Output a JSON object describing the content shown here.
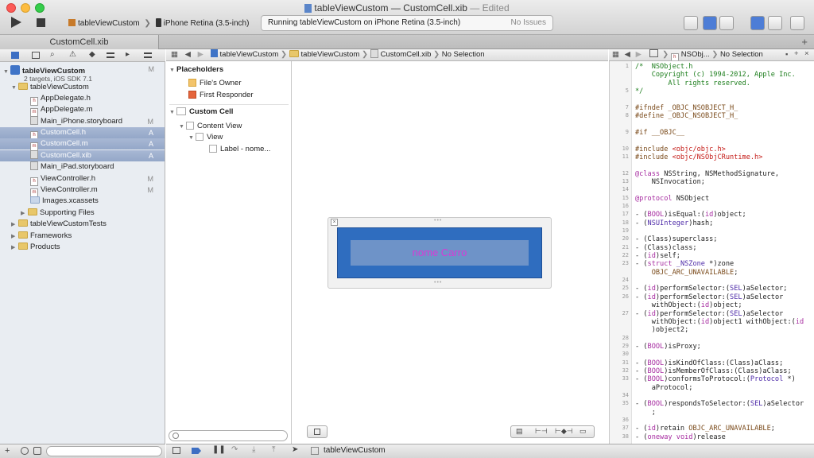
{
  "window": {
    "title_project": "tableViewCustom",
    "title_sep": " — ",
    "title_file": "CustomCell.xib",
    "title_state": " — Edited"
  },
  "toolbar": {
    "scheme": "tableViewCustom",
    "device": "iPhone Retina (3.5-inch)",
    "status": "Running tableViewCustom on iPhone Retina (3.5-inch)",
    "issues": "No Issues"
  },
  "tab": {
    "label": "CustomCell.xib"
  },
  "navigator": {
    "project": "tableViewCustom",
    "project_sub": "2 targets, iOS SDK 7.1",
    "project_badge": "M",
    "items": [
      {
        "label": "tableViewCustom",
        "badge": ""
      },
      {
        "label": "AppDelegate.h",
        "badge": ""
      },
      {
        "label": "AppDelegate.m",
        "badge": ""
      },
      {
        "label": "Main_iPhone.storyboard",
        "badge": "M"
      },
      {
        "label": "CustomCell.h",
        "badge": "A"
      },
      {
        "label": "CustomCell.m",
        "badge": "A"
      },
      {
        "label": "CustomCell.xib",
        "badge": "A"
      },
      {
        "label": "Main_iPad.storyboard",
        "badge": ""
      },
      {
        "label": "ViewController.h",
        "badge": "M"
      },
      {
        "label": "ViewController.m",
        "badge": "M"
      },
      {
        "label": "Images.xcassets",
        "badge": ""
      },
      {
        "label": "Supporting Files",
        "badge": ""
      },
      {
        "label": "tableViewCustomTests",
        "badge": ""
      },
      {
        "label": "Frameworks",
        "badge": ""
      },
      {
        "label": "Products",
        "badge": ""
      }
    ]
  },
  "editor_path": {
    "p1": "tableViewCustom",
    "p2": "tableViewCustom",
    "p3": "CustomCell.xib",
    "p4": "No Selection"
  },
  "outline": {
    "placeholders": "Placeholders",
    "files_owner": "File's Owner",
    "first_responder": "First Responder",
    "custom_cell": "Custom Cell",
    "content_view": "Content View",
    "view": "View",
    "label": "Label - nome..."
  },
  "canvas": {
    "label_text": "nome Carro",
    "label_color": "#d63bd6",
    "cell_color": "#2f6dbf"
  },
  "assistant_path": {
    "file": "NSObj...",
    "sel": "No Selection"
  },
  "code": {
    "lines": [
      {
        "n": "1",
        "t": "/*  NSObject.h"
      },
      {
        "n": "",
        "t": "    Copyright (c) 1994-2012, Apple Inc."
      },
      {
        "n": "",
        "t": "        All rights reserved."
      },
      {
        "n": "5",
        "t": "*/"
      },
      {
        "n": "",
        "t": ""
      },
      {
        "n": "7",
        "t": "#ifndef _OBJC_NSOBJECT_H_"
      },
      {
        "n": "8",
        "t": "#define _OBJC_NSOBJECT_H_"
      },
      {
        "n": "",
        "t": ""
      },
      {
        "n": "9",
        "t": "#if __OBJC__"
      },
      {
        "n": "",
        "t": ""
      },
      {
        "n": "10",
        "t": "#include <objc/objc.h>"
      },
      {
        "n": "11",
        "t": "#include <objc/NSObjCRuntime.h>"
      },
      {
        "n": "",
        "t": ""
      },
      {
        "n": "12",
        "t": "@class NSString, NSMethodSignature,"
      },
      {
        "n": "13",
        "t": "    NSInvocation;"
      },
      {
        "n": "14",
        "t": ""
      },
      {
        "n": "15",
        "t": "@protocol NSObject"
      },
      {
        "n": "16",
        "t": ""
      },
      {
        "n": "17",
        "t": "- (BOOL)isEqual:(id)object;"
      },
      {
        "n": "18",
        "t": "- (NSUInteger)hash;"
      },
      {
        "n": "19",
        "t": ""
      },
      {
        "n": "20",
        "t": "- (Class)superclass;"
      },
      {
        "n": "21",
        "t": "- (Class)class;"
      },
      {
        "n": "22",
        "t": "- (id)self;"
      },
      {
        "n": "23",
        "t": "- (struct _NSZone *)zone"
      },
      {
        "n": "",
        "t": "    OBJC_ARC_UNAVAILABLE;"
      },
      {
        "n": "24",
        "t": ""
      },
      {
        "n": "25",
        "t": "- (id)performSelector:(SEL)aSelector;"
      },
      {
        "n": "26",
        "t": "- (id)performSelector:(SEL)aSelector"
      },
      {
        "n": "",
        "t": "    withObject:(id)object;"
      },
      {
        "n": "27",
        "t": "- (id)performSelector:(SEL)aSelector"
      },
      {
        "n": "",
        "t": "    withObject:(id)object1 withObject:(id"
      },
      {
        "n": "",
        "t": "    )object2;"
      },
      {
        "n": "28",
        "t": ""
      },
      {
        "n": "29",
        "t": "- (BOOL)isProxy;"
      },
      {
        "n": "30",
        "t": ""
      },
      {
        "n": "31",
        "t": "- (BOOL)isKindOfClass:(Class)aClass;"
      },
      {
        "n": "32",
        "t": "- (BOOL)isMemberOfClass:(Class)aClass;"
      },
      {
        "n": "33",
        "t": "- (BOOL)conformsToProtocol:(Protocol *)"
      },
      {
        "n": "",
        "t": "    aProtocol;"
      },
      {
        "n": "34",
        "t": ""
      },
      {
        "n": "35",
        "t": "- (BOOL)respondsToSelector:(SEL)aSelector"
      },
      {
        "n": "",
        "t": "    ;"
      },
      {
        "n": "36",
        "t": ""
      },
      {
        "n": "37",
        "t": "- (id)retain OBJC_ARC_UNAVAILABLE;"
      },
      {
        "n": "38",
        "t": "- (oneway void)release"
      }
    ]
  },
  "debug": {
    "target": "tableViewCustom"
  }
}
